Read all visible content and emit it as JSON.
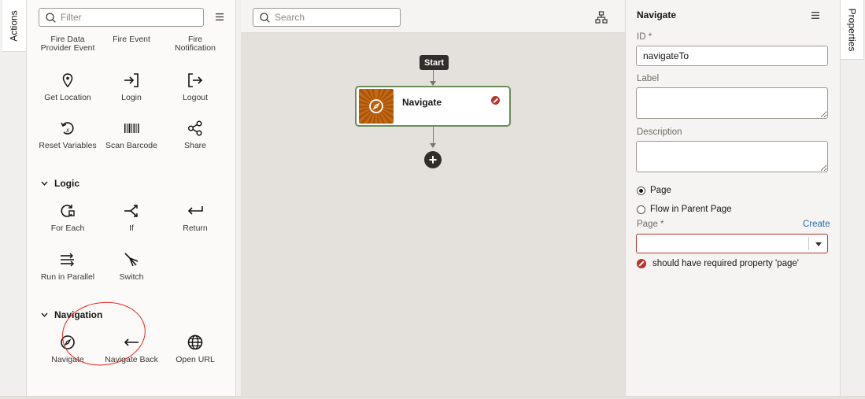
{
  "left_rail": {
    "tab_label": "Actions"
  },
  "palette": {
    "filter_placeholder": "Filter",
    "menu_icon": "hamburger-icon",
    "top_items": [
      {
        "label_line1": "Fire Data",
        "label_line2": "Provider Event"
      },
      {
        "label_line1": "Fire Event",
        "label_line2": ""
      },
      {
        "label_line1": "Fire",
        "label_line2": "Notification"
      }
    ],
    "general_items": [
      {
        "label": "Get Location",
        "icon": "location-pin-icon"
      },
      {
        "label": "Login",
        "icon": "login-icon"
      },
      {
        "label": "Logout",
        "icon": "logout-icon"
      },
      {
        "label": "Reset Variables",
        "icon": "reset-variables-icon"
      },
      {
        "label": "Scan Barcode",
        "icon": "barcode-icon"
      },
      {
        "label": "Share",
        "icon": "share-icon"
      }
    ],
    "logic": {
      "title": "Logic",
      "items": [
        {
          "label": "For Each",
          "icon": "loop-icon"
        },
        {
          "label": "If",
          "icon": "branch-icon"
        },
        {
          "label": "Return",
          "icon": "return-icon"
        },
        {
          "label": "Run in Parallel",
          "icon": "parallel-icon"
        },
        {
          "label": "Switch",
          "icon": "switch-icon"
        }
      ]
    },
    "navigation": {
      "title": "Navigation",
      "items": [
        {
          "label": "Navigate",
          "icon": "compass-icon"
        },
        {
          "label": "Navigate Back",
          "icon": "back-arrow-icon"
        },
        {
          "label": "Open URL",
          "icon": "globe-icon"
        }
      ]
    }
  },
  "canvas": {
    "search_placeholder": "Search",
    "start_label": "Start",
    "node": {
      "title": "Navigate",
      "status": "error"
    }
  },
  "properties": {
    "title": "Navigate",
    "id_label": "ID *",
    "id_value": "navigateTo",
    "label_label": "Label",
    "label_value": "",
    "description_label": "Description",
    "description_value": "",
    "radio_page": "Page",
    "radio_flow": "Flow in Parent Page",
    "selected_radio": "Page",
    "page_label": "Page *",
    "create_link": "Create",
    "page_value": "",
    "error_message": "should have required property 'page'"
  },
  "right_rail": {
    "tab_label": "Properties"
  },
  "colors": {
    "error": "#b5362b",
    "node_border": "#6b8e5a",
    "node_icon": "#c46a12",
    "annotation": "#e0261f",
    "link": "#1f6fb2"
  }
}
